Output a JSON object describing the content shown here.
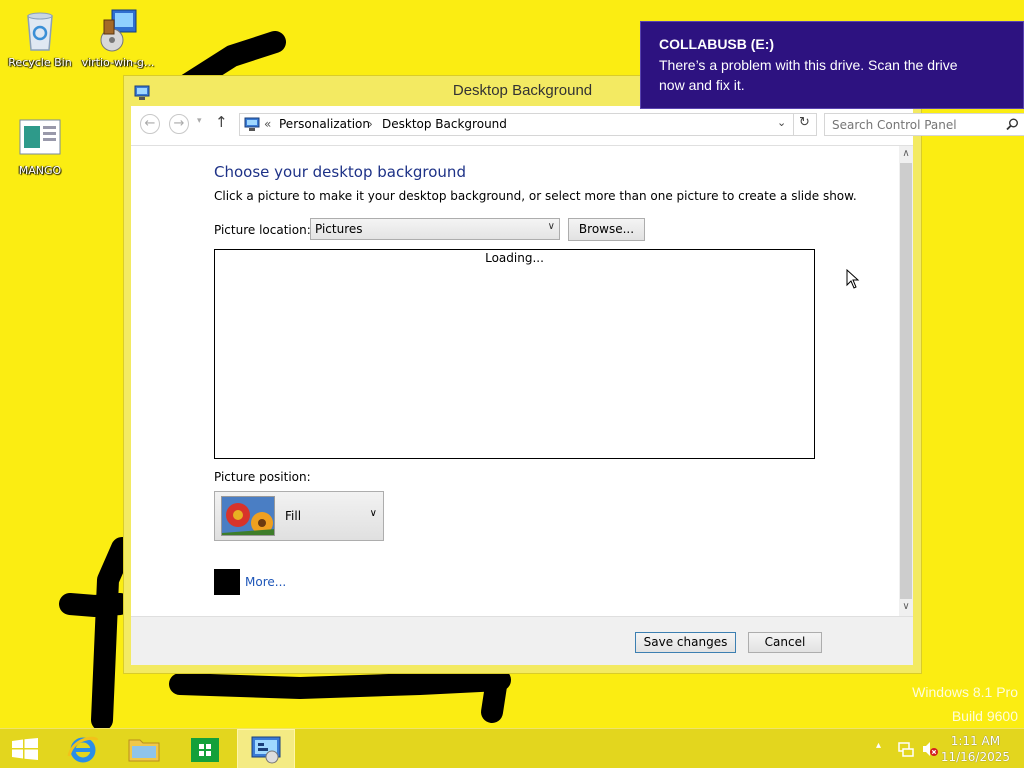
{
  "desktop": {
    "icons": [
      {
        "label": "Recycle Bin",
        "icon": "recycle-bin-icon"
      },
      {
        "label": "virtio-win-g...",
        "icon": "installer-icon"
      },
      {
        "label": "MANGO",
        "icon": "document-icon"
      }
    ],
    "watermark": {
      "line1": "Windows 8.1 Pro",
      "line2": "Build 9600"
    }
  },
  "notification": {
    "title": "COLLABUSB (E:)",
    "body": "There’s a problem with this drive.  Scan the drive now and fix it."
  },
  "window": {
    "title": "Desktop Background",
    "nav": {
      "back": "←",
      "forward": "→",
      "recent": "▾",
      "up": "↑",
      "refresh": "↻"
    },
    "breadcrumb": {
      "prefix": "«",
      "parent": "Personalization",
      "separator": "›",
      "current": "Desktop Background"
    },
    "search_placeholder": "Search Control Panel",
    "heading": "Choose your desktop background",
    "subtitle": "Click a picture to make it your desktop background, or select more than one picture to create a slide show.",
    "picture_location": {
      "label": "Picture location:",
      "value": "Pictures",
      "browse": "Browse..."
    },
    "gallery": {
      "status": "Loading..."
    },
    "picture_position": {
      "label": "Picture position:",
      "value": "Fill"
    },
    "more_link": "More...",
    "footer": {
      "save": "Save changes",
      "cancel": "Cancel"
    }
  },
  "taskbar": {
    "items": [
      "start-button",
      "internet-explorer",
      "file-explorer",
      "store",
      "control-panel"
    ],
    "active": "control-panel",
    "clock": {
      "time": "1:11 AM",
      "date": "11/16/2025"
    },
    "tray": {
      "show_hidden": "▴"
    }
  },
  "colors": {
    "desktop": "#fbed12",
    "notification": "#2d1280",
    "heading": "#1e3287",
    "link": "#1e56b8",
    "taskbar": "#e3d61e"
  }
}
